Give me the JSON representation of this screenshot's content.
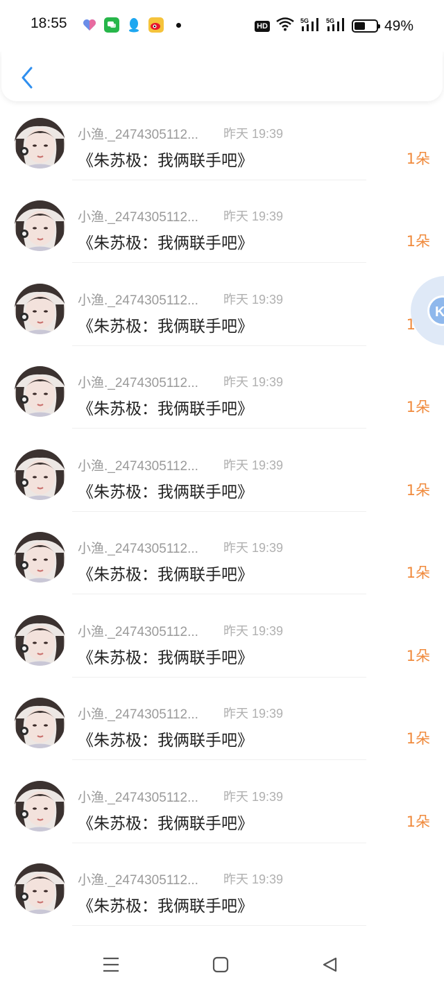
{
  "status_bar": {
    "time": "18:55",
    "hd_label": "HD",
    "battery_text": "49%",
    "battery_level": 0.49,
    "notifications": [
      "health-icon",
      "chat-icon",
      "qq-icon",
      "weibo-icon"
    ]
  },
  "colors": {
    "accent": "#2f8fef",
    "count": "#f08a3c",
    "name": "#9a9a9a",
    "time": "#b0b0b0"
  },
  "rows": [
    {
      "name": "",
      "time": "",
      "message": "《朱苏极：我俩联手吧》",
      "count": "1朵"
    },
    {
      "name": "小渔._2474305112...",
      "time": "昨天 19:39",
      "message": "《朱苏极：我俩联手吧》",
      "count": "1朵"
    },
    {
      "name": "小渔._2474305112...",
      "time": "昨天 19:39",
      "message": "《朱苏极：我俩联手吧》",
      "count": "1朵"
    },
    {
      "name": "小渔._2474305112...",
      "time": "昨天 19:39",
      "message": "《朱苏极：我俩联手吧》",
      "count": "1朵"
    },
    {
      "name": "小渔._2474305112...",
      "time": "昨天 19:39",
      "message": "《朱苏极：我俩联手吧》",
      "count": "1朵"
    },
    {
      "name": "小渔._2474305112...",
      "time": "昨天 19:39",
      "message": "《朱苏极：我俩联手吧》",
      "count": "1朵"
    },
    {
      "name": "小渔._2474305112...",
      "time": "昨天 19:39",
      "message": "《朱苏极：我俩联手吧》",
      "count": "1朵"
    },
    {
      "name": "小渔._2474305112...",
      "time": "昨天 19:39",
      "message": "《朱苏极：我俩联手吧》",
      "count": "1朵"
    },
    {
      "name": "小渔._2474305112...",
      "time": "昨天 19:39",
      "message": "《朱苏极：我俩联手吧》",
      "count": "1朵"
    },
    {
      "name": "小渔._2474305112...",
      "time": "昨天 19:39",
      "message": "《朱苏极：我俩联手吧》",
      "count": "1朵"
    },
    {
      "name": "小渔._2474305112...",
      "time": "昨天 19:39",
      "message": "《朱苏极：我俩联手吧》",
      "count": ""
    }
  ]
}
